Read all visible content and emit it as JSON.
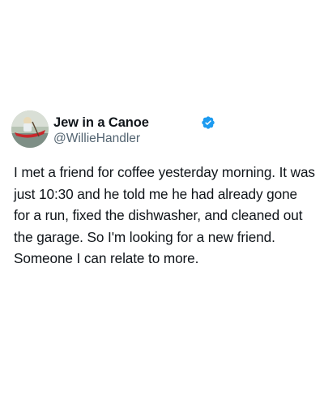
{
  "author": {
    "display_name": "Jew in a Canoe",
    "handle": "@WillieHandler",
    "verified": true,
    "avatar_icon": "profile-photo-canoe",
    "verified_icon": "verified-badge-icon",
    "verified_color": "#1d9bf0"
  },
  "tweet": {
    "text": "I met a friend for coffee yesterday morning. It was just 10:30 and he told me he had already gone for a run, fixed the dishwasher, and cleaned out the garage. So I'm looking for a new friend. Someone I can relate to more."
  },
  "colors": {
    "background": "#ffffff",
    "text_primary": "#0f1419",
    "text_secondary": "#536471"
  }
}
